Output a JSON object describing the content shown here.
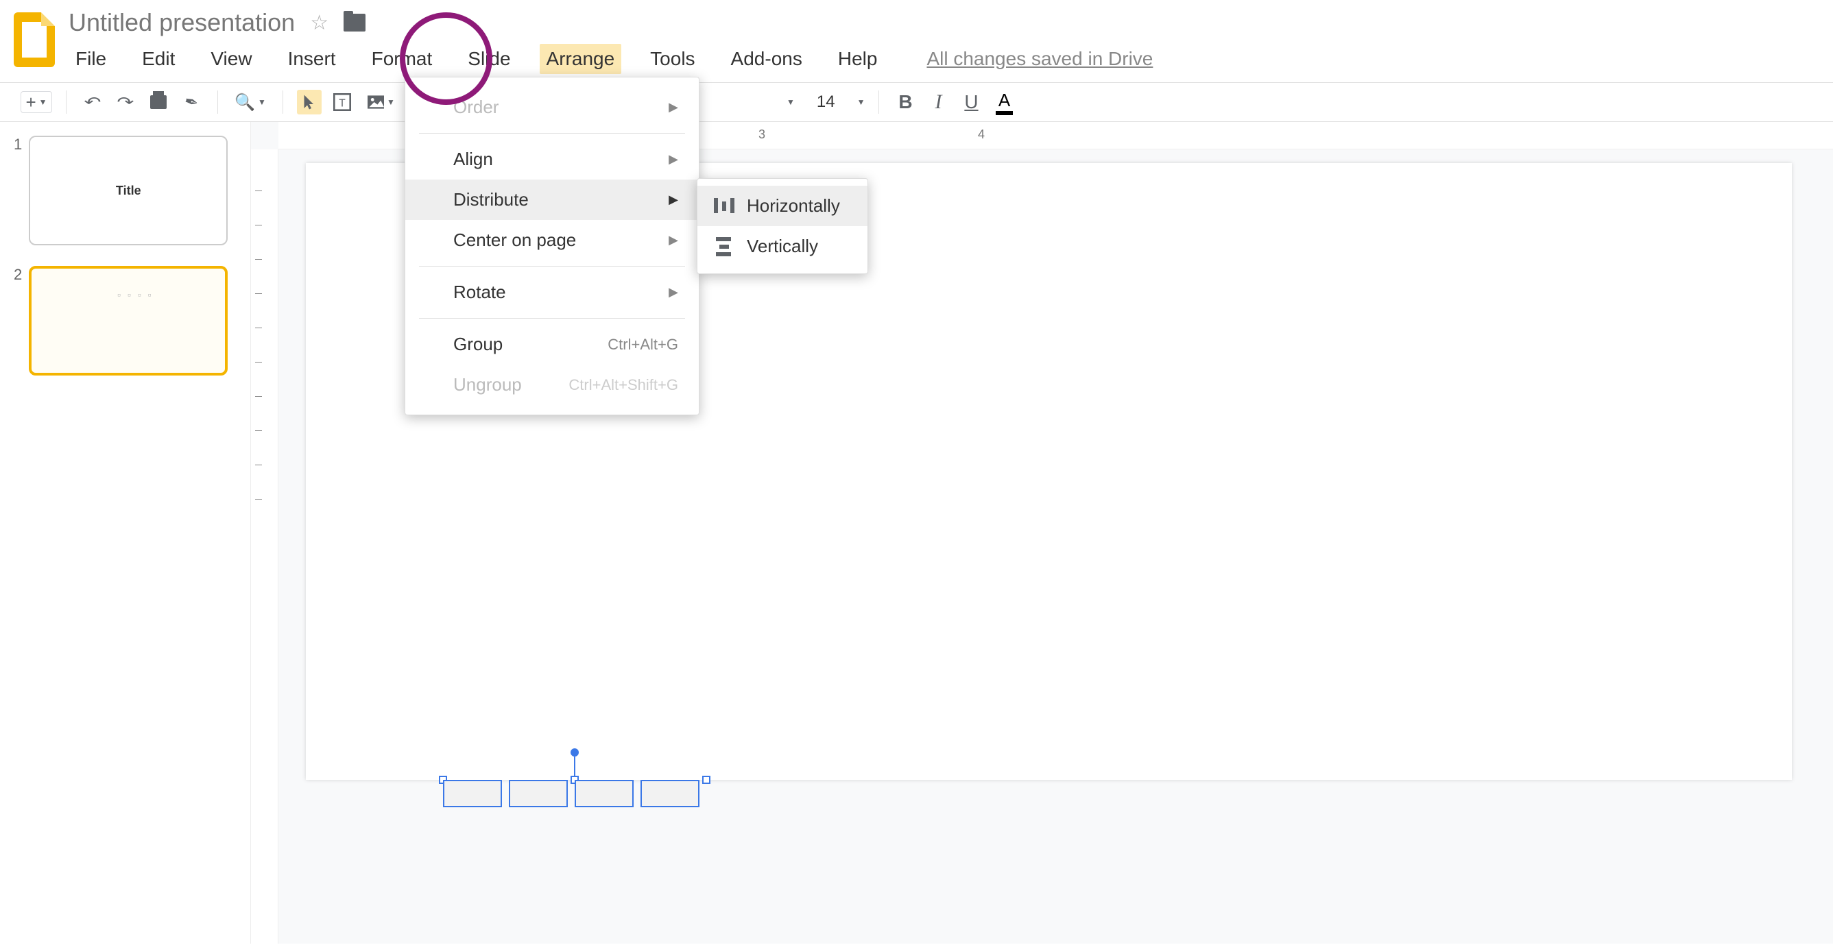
{
  "doc": {
    "title": "Untitled presentation",
    "save_status": "All changes saved in Drive"
  },
  "menus": {
    "file": "File",
    "edit": "Edit",
    "view": "View",
    "insert": "Insert",
    "format": "Format",
    "slide": "Slide",
    "arrange": "Arrange",
    "tools": "Tools",
    "addons": "Add-ons",
    "help": "Help"
  },
  "toolbar": {
    "font_size": "14"
  },
  "slides": {
    "numbers": [
      "1",
      "2"
    ],
    "thumb1_label": "Title"
  },
  "ruler": {
    "n3": "3",
    "n4": "4"
  },
  "arrange_menu": {
    "order": "Order",
    "align": "Align",
    "distribute": "Distribute",
    "center": "Center on page",
    "rotate": "Rotate",
    "group": "Group",
    "group_sc": "Ctrl+Alt+G",
    "ungroup": "Ungroup",
    "ungroup_sc": "Ctrl+Alt+Shift+G"
  },
  "distribute_submenu": {
    "horizontally": "Horizontally",
    "vertically": "Vertically"
  }
}
